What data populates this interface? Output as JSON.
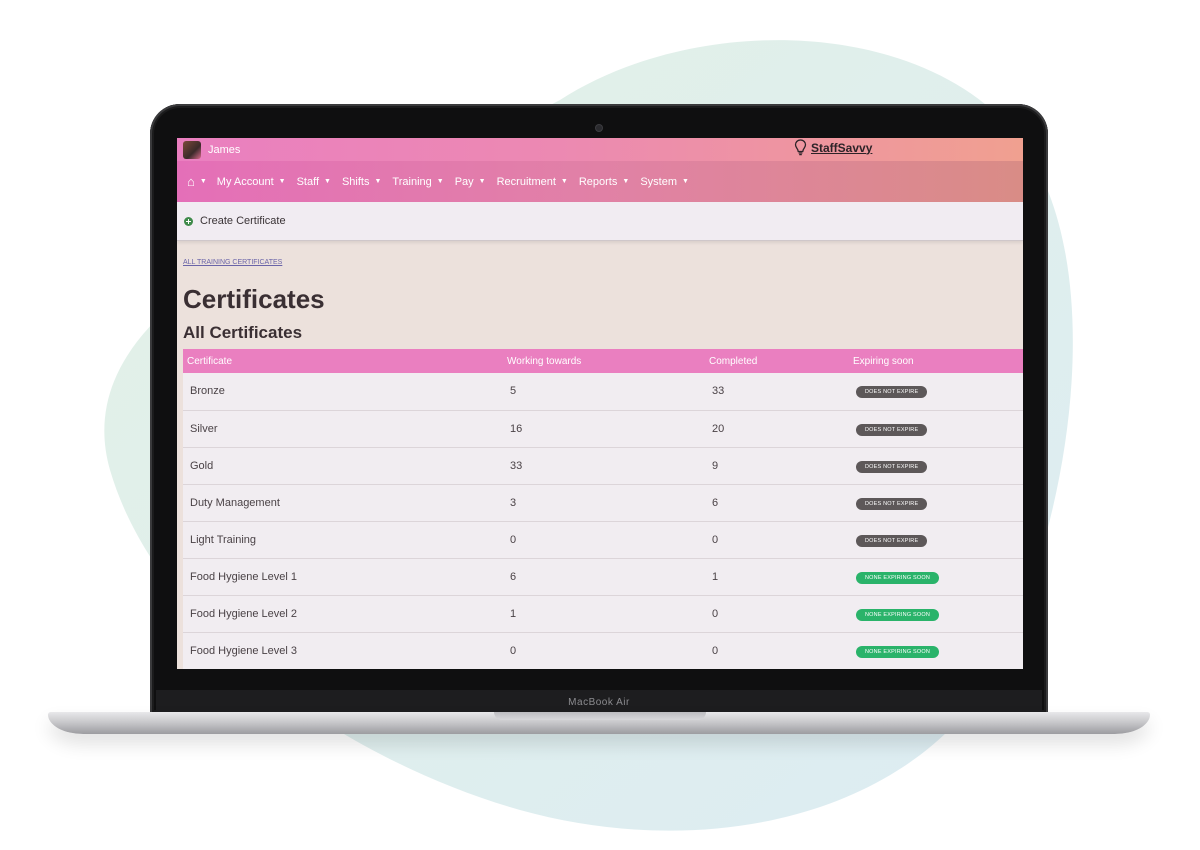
{
  "user": {
    "name": "James"
  },
  "brand": {
    "name": "StaffSavvy"
  },
  "nav": {
    "items": [
      {
        "label": "My Account"
      },
      {
        "label": "Staff"
      },
      {
        "label": "Shifts"
      },
      {
        "label": "Training"
      },
      {
        "label": "Pay"
      },
      {
        "label": "Recruitment"
      },
      {
        "label": "Reports"
      },
      {
        "label": "System"
      }
    ]
  },
  "toolbar": {
    "create_label": "Create Certificate"
  },
  "breadcrumb": "ALL TRAINING CERTIFICATES",
  "page": {
    "title": "Certificates",
    "subtitle": "All Certificates"
  },
  "table": {
    "headers": [
      "Certificate",
      "Working towards",
      "Completed",
      "Expiring soon"
    ],
    "rows": [
      {
        "name": "Bronze",
        "working": "5",
        "completed": "33",
        "status": "DOES NOT EXPIRE",
        "status_color": "#5d5859"
      },
      {
        "name": "Silver",
        "working": "16",
        "completed": "20",
        "status": "DOES NOT EXPIRE",
        "status_color": "#5d5859"
      },
      {
        "name": "Gold",
        "working": "33",
        "completed": "9",
        "status": "DOES NOT EXPIRE",
        "status_color": "#5d5859"
      },
      {
        "name": "Duty Management",
        "working": "3",
        "completed": "6",
        "status": "DOES NOT EXPIRE",
        "status_color": "#5d5859"
      },
      {
        "name": "Light Training",
        "working": "0",
        "completed": "0",
        "status": "DOES NOT EXPIRE",
        "status_color": "#5d5859"
      },
      {
        "name": "Food Hygiene Level 1",
        "working": "6",
        "completed": "1",
        "status": "NONE EXPIRING SOON",
        "status_color": "#2ab36a"
      },
      {
        "name": "Food Hygiene Level 2",
        "working": "1",
        "completed": "0",
        "status": "NONE EXPIRING SOON",
        "status_color": "#2ab36a"
      },
      {
        "name": "Food Hygiene Level 3",
        "working": "0",
        "completed": "0",
        "status": "NONE EXPIRING SOON",
        "status_color": "#2ab36a"
      }
    ]
  },
  "device": {
    "label": "MacBook Air"
  },
  "colors": {
    "accent": "#ea7fc0",
    "nav_end": "#d98c86",
    "success": "#2ab36a",
    "neutral_badge": "#5d5859"
  },
  "icons": {
    "home": "home-icon",
    "create": "plus-circle-icon",
    "brand": "lightbulb-icon",
    "caret": "caret-down-icon"
  }
}
